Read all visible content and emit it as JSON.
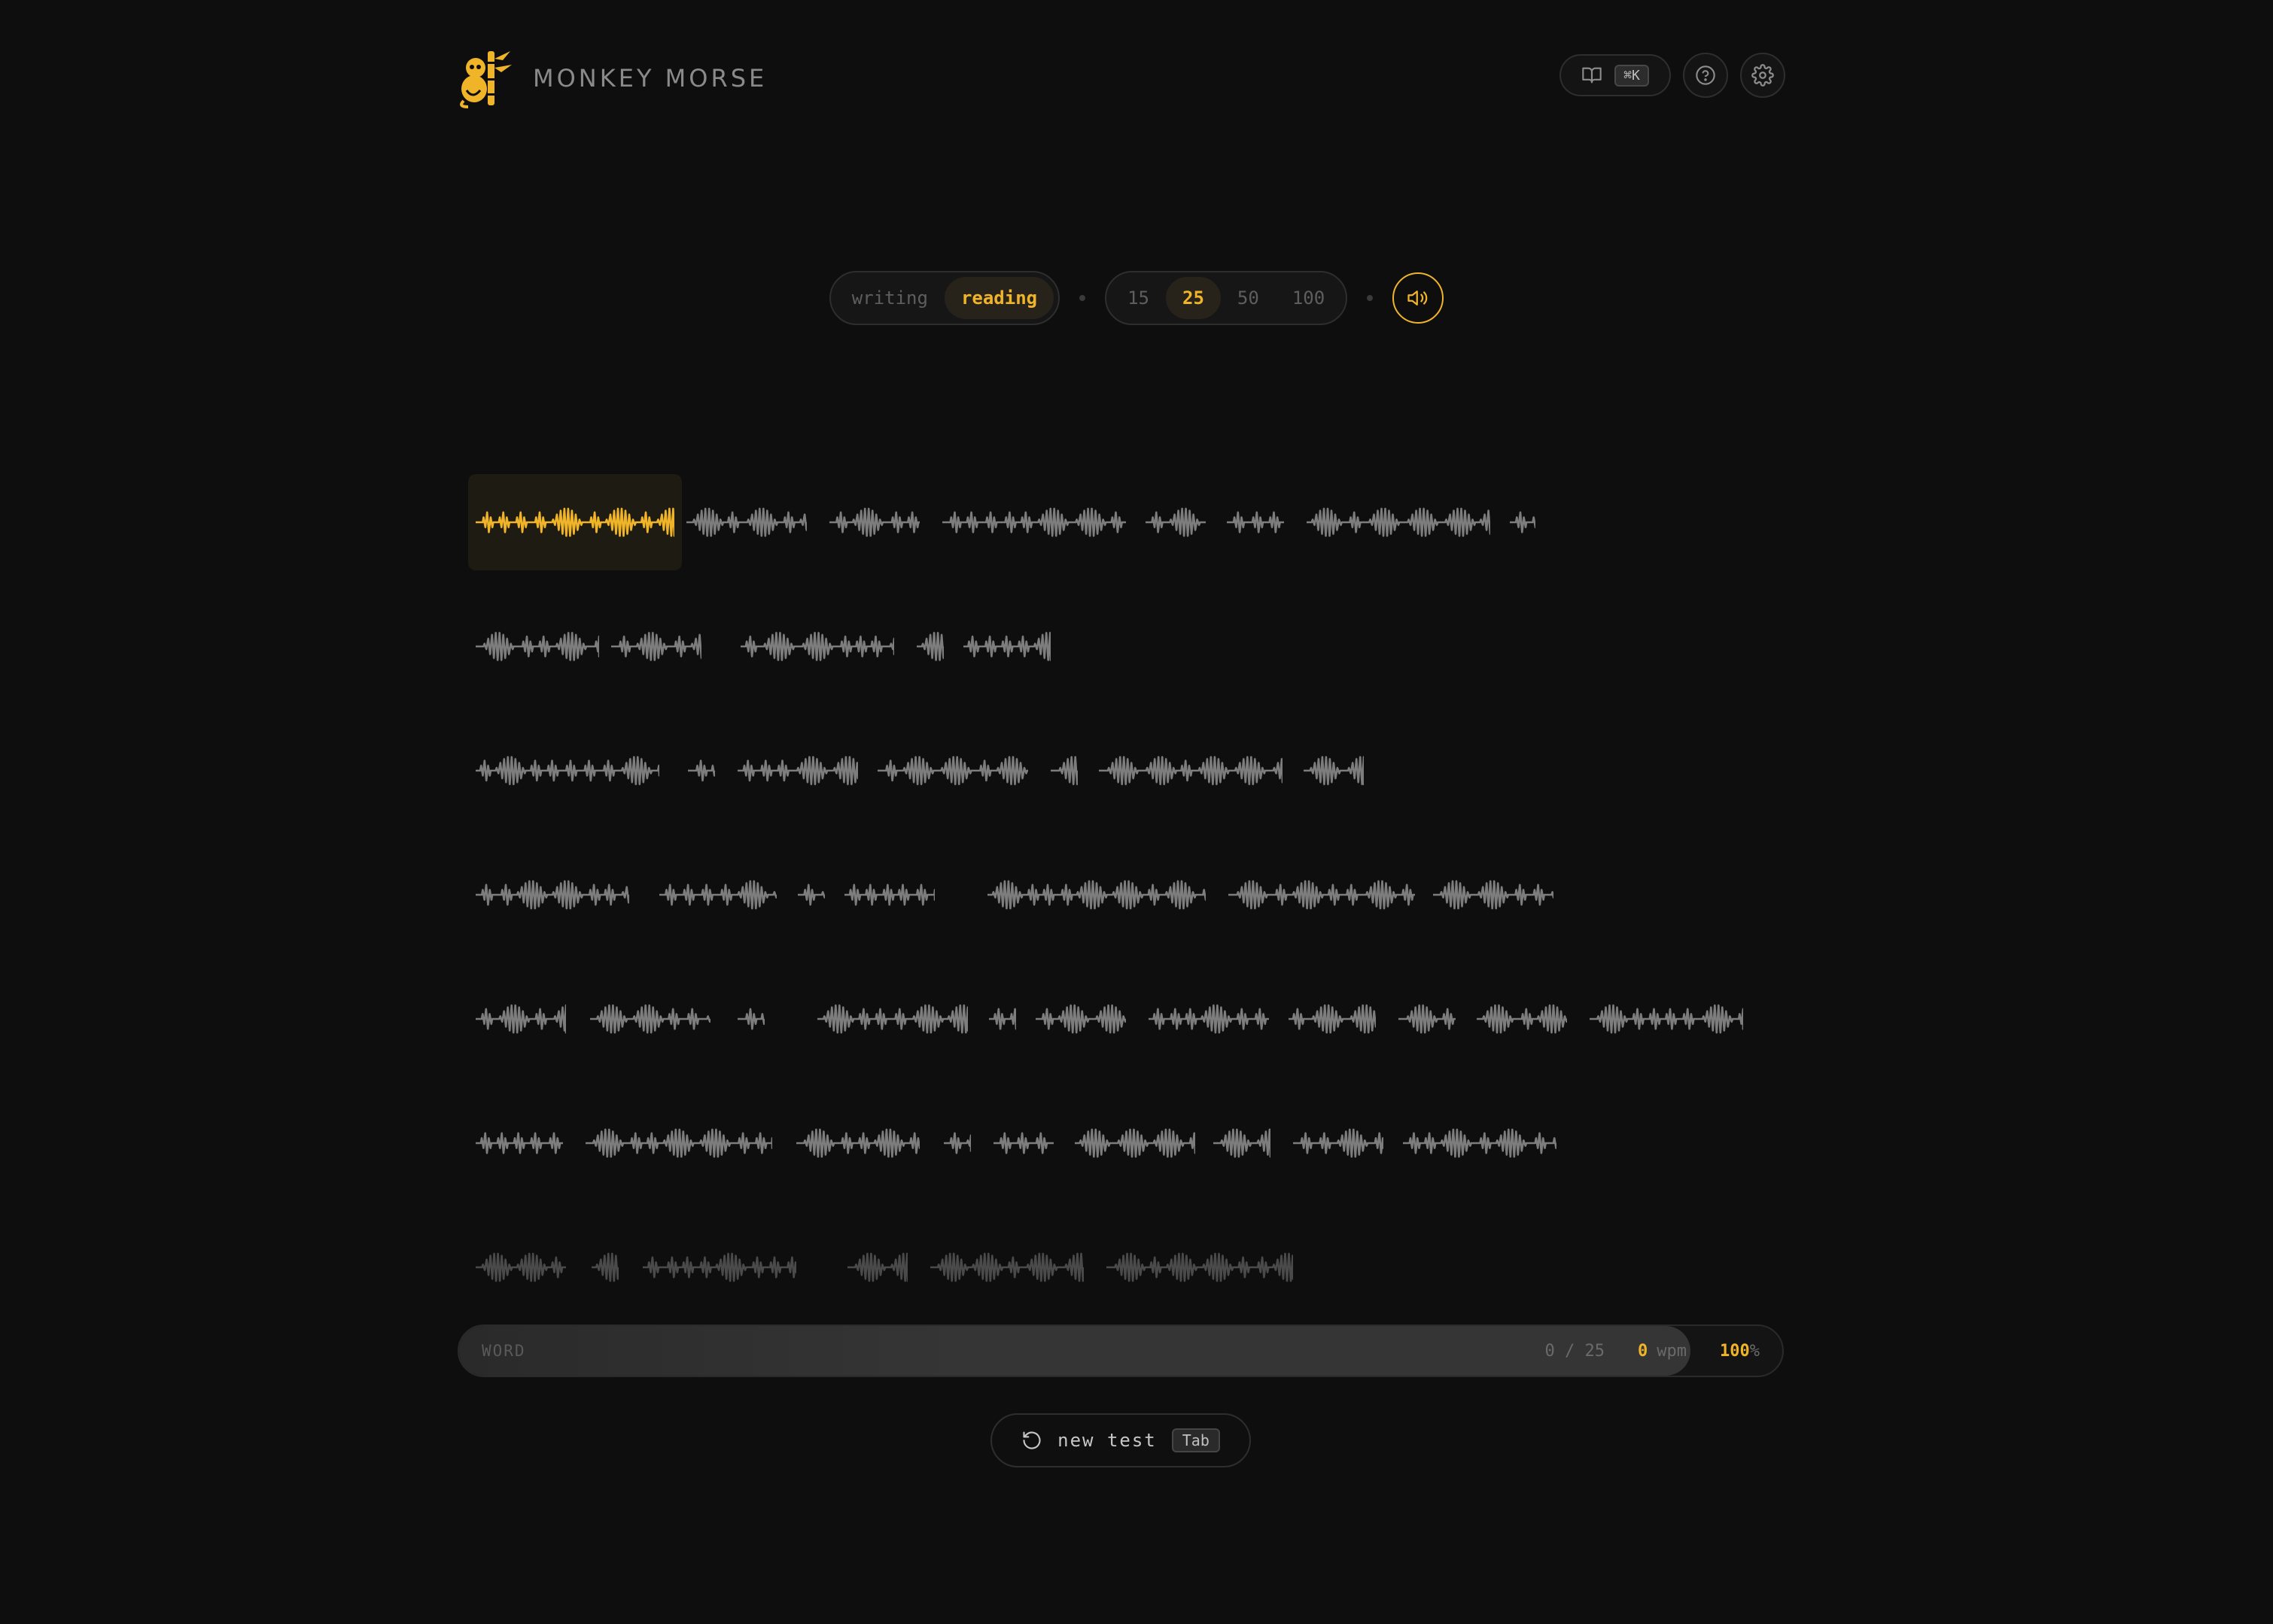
{
  "app": {
    "title": "MONKEY MORSE"
  },
  "header": {
    "command_shortcut": "⌘K",
    "icons": [
      "book-icon",
      "help-icon",
      "gear-icon"
    ]
  },
  "controls": {
    "modes": [
      {
        "label": "writing",
        "active": false
      },
      {
        "label": "reading",
        "active": true
      }
    ],
    "word_counts": [
      {
        "label": "15",
        "active": false
      },
      {
        "label": "25",
        "active": true
      },
      {
        "label": "50",
        "active": false
      },
      {
        "label": "100",
        "active": false
      }
    ],
    "sound_icon": "speaker-icon"
  },
  "status": {
    "label": "WORD",
    "progress": "0 / 25",
    "wpm_value": "0",
    "wpm_unit": "wpm",
    "accuracy_value": "100",
    "accuracy_unit": "%",
    "accuracy_fraction": 1.0
  },
  "new_test": {
    "label": "new test",
    "shortcut": "Tab",
    "icon": "restart-icon"
  },
  "colors": {
    "accent": "#f0b429",
    "wave": "#7d7d7d",
    "wave_dim": "#4a4a4a",
    "background": "#0e0e0e"
  }
}
